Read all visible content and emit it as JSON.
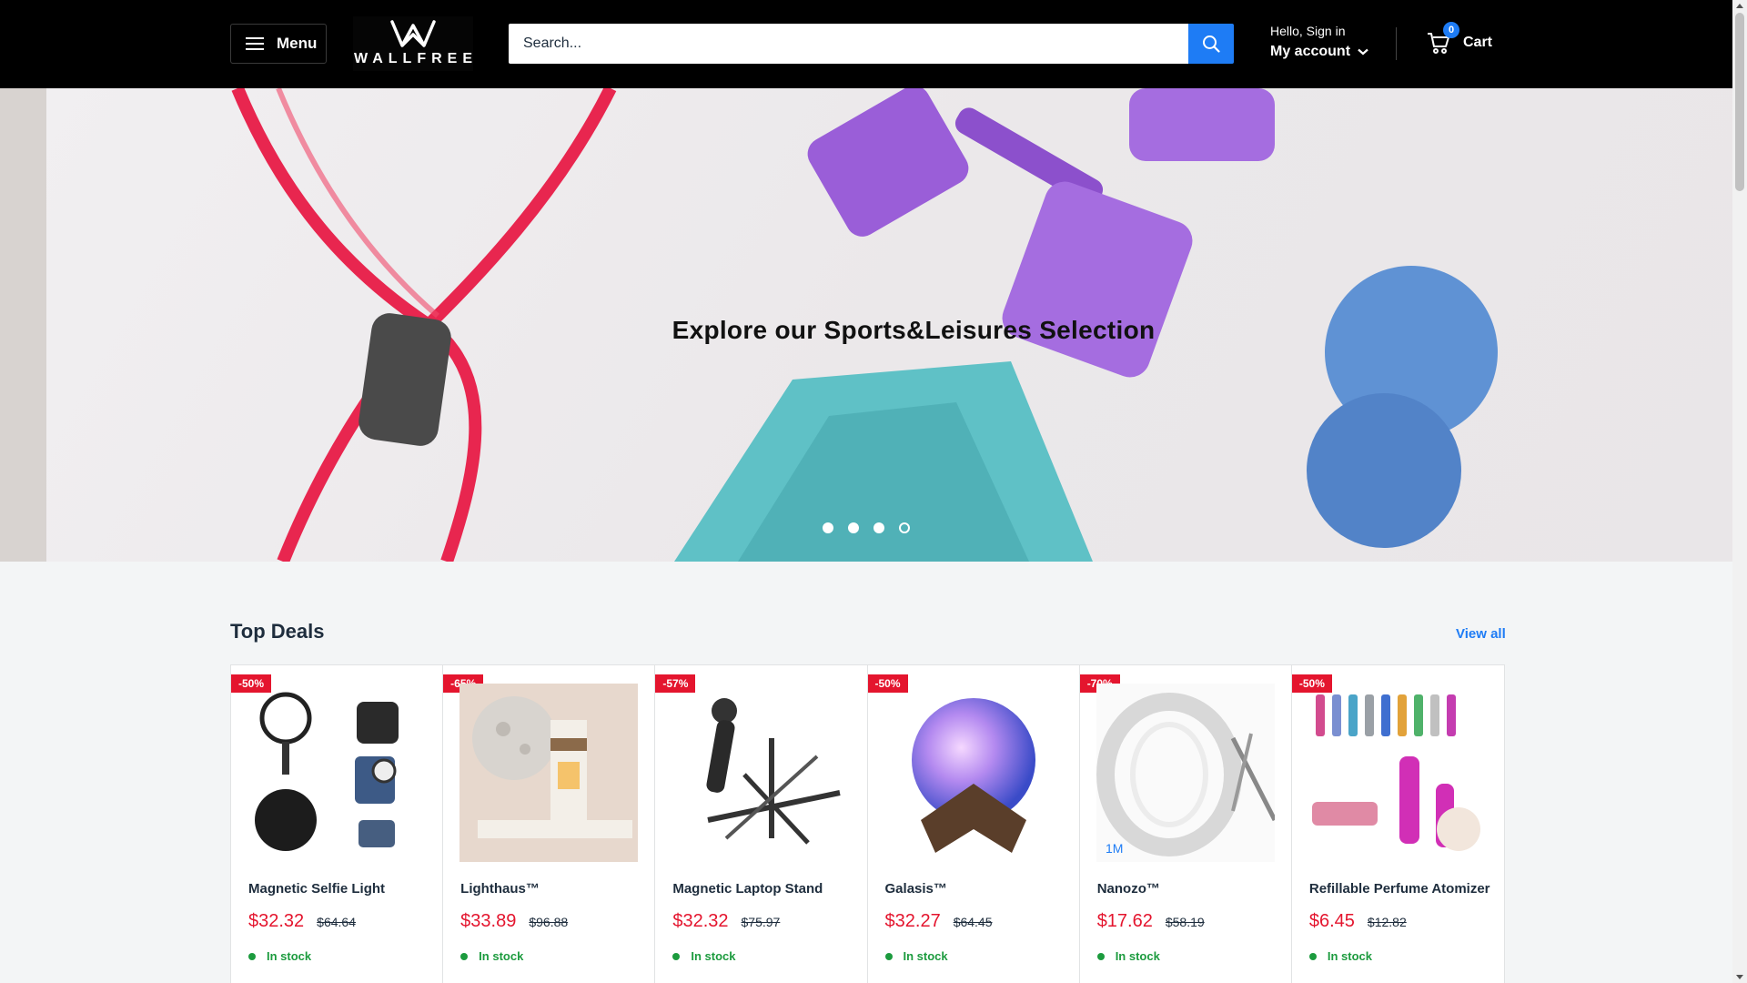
{
  "header": {
    "menu_label": "Menu",
    "logo_text": "WALLFREE",
    "search_placeholder": "Search...",
    "account_greeting": "Hello, Sign in",
    "account_label": "My account",
    "cart_label": "Cart",
    "cart_count": "0"
  },
  "hero": {
    "title": "Explore our Sports&Leisures Selection",
    "slides_count": 4,
    "active_slide": 4
  },
  "deals": {
    "title": "Top Deals",
    "view_all_label": "View all",
    "products": [
      {
        "badge": "-50%",
        "name": "Magnetic Selfie Light",
        "price": "$32.32",
        "old_price": "$64.64",
        "stock": "In stock"
      },
      {
        "badge": "-65%",
        "name": "Lighthaus™",
        "price": "$33.89",
        "old_price": "$96.88",
        "stock": "In stock"
      },
      {
        "badge": "-57%",
        "name": "Magnetic Laptop Stand",
        "price": "$32.32",
        "old_price": "$75.97",
        "stock": "In stock"
      },
      {
        "badge": "-50%",
        "name": "Galasis™",
        "price": "$32.27",
        "old_price": "$64.45",
        "stock": "In stock"
      },
      {
        "badge": "-70%",
        "name": "Nanozo™",
        "price": "$17.62",
        "old_price": "$58.19",
        "stock": "In stock",
        "image_label": "1M"
      },
      {
        "badge": "-50%",
        "name": "Refillable Perfume Atomizer",
        "price": "$6.45",
        "old_price": "$12.82",
        "stock": "In stock"
      }
    ]
  },
  "colors": {
    "header_bg": "#000000",
    "accent": "#1e7cf5",
    "sale_red": "#e4152e",
    "stock_green": "#1c9b3e"
  }
}
